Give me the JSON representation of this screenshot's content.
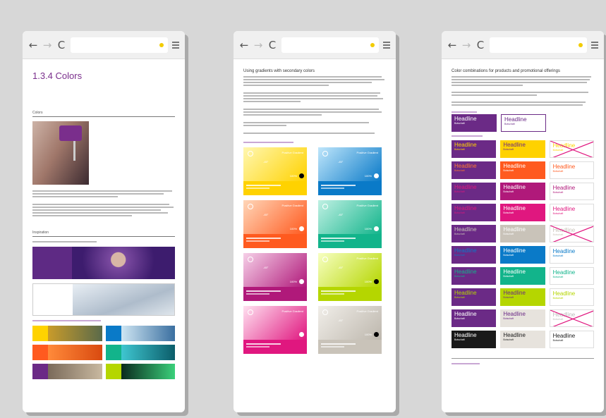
{
  "brand": {
    "purple": "#7a2e8c",
    "yellow": "#ffd200",
    "blue": "#0a7ac8"
  },
  "browser": {
    "back_icon": "←",
    "forward_icon": "→",
    "reload_icon": "C"
  },
  "screen1": {
    "title": "1.3.4 Colors",
    "section_colors": "Colors",
    "section_inspiration": "Inspiration"
  },
  "screen2": {
    "title": "Using gradients with secondary colors"
  },
  "screen3": {
    "title": "Color combinations for products and promotional offerings"
  },
  "gradient_tiles": [
    {
      "from": "#fff7b0",
      "to": "#ffd200",
      "bottom": "#ffd200",
      "label": "Positive Gradient",
      "angle": "-45°",
      "percent": "100%",
      "dark_dot": true
    },
    {
      "from": "#bfe6fb",
      "to": "#0a7ac8",
      "bottom": "#0a7ac8",
      "label": "Positive Gradient",
      "angle": "-45°",
      "percent": "100%",
      "dark_dot": false
    },
    {
      "from": "#ffd6b8",
      "to": "#ff5a1f",
      "bottom": "#ff5a1f",
      "label": "Positive Gradient",
      "angle": "-45°",
      "percent": "100%",
      "dark_dot": false
    },
    {
      "from": "#bff0e3",
      "to": "#12b48b",
      "bottom": "#12b48b",
      "label": "Positive Gradient",
      "angle": "-45°",
      "percent": "100%",
      "dark_dot": false
    },
    {
      "from": "#f6d0e8",
      "to": "#b0197a",
      "bottom": "#b0197a",
      "label": "",
      "angle": "-45°",
      "percent": "100%",
      "dark_dot": false
    },
    {
      "from": "#f7ffc2",
      "to": "#b5d600",
      "bottom": "#b5d600",
      "label": "Positive Gradient",
      "angle": "-45°",
      "percent": "100%",
      "dark_dot": true
    },
    {
      "from": "#ffe0f0",
      "to": "#e0177f",
      "bottom": "#e0177f",
      "label": "Positive Gradient",
      "angle": "",
      "percent": "",
      "dark_dot": false
    },
    {
      "from": "#f1eee9",
      "to": "#bdb7ad",
      "bottom": "#c9c3b9",
      "label": "Positive Gradient",
      "angle": "-45°",
      "percent": "100%",
      "dark_dot": true
    }
  ],
  "headline_rows": [
    [
      {
        "bg": "#6b2a86",
        "fg": "#ffffff",
        "text": "Headline",
        "sub": "Botschaft",
        "crossed": false,
        "border": ""
      },
      {
        "bg": "#ffffff",
        "fg": "#6b2a86",
        "text": "Headline",
        "sub": "Botschaft",
        "crossed": false,
        "border": "#6b2a86"
      }
    ],
    [
      {
        "bg": "#6b2a86",
        "fg": "#ffd200",
        "text": "Headline",
        "sub": "Botschaft",
        "crossed": false,
        "border": ""
      },
      {
        "bg": "#ffd200",
        "fg": "#6b2a86",
        "text": "Headline",
        "sub": "Botschaft",
        "crossed": false,
        "border": ""
      },
      {
        "bg": "#ffffff",
        "fg": "#ffd200",
        "text": "Headline",
        "sub": "Botschaft",
        "crossed": true,
        "border": "#ddd"
      }
    ],
    [
      {
        "bg": "#6b2a86",
        "fg": "#ff7a30",
        "text": "Headline",
        "sub": "Botschaft",
        "crossed": false,
        "border": ""
      },
      {
        "bg": "#ff5a1f",
        "fg": "#ffffff",
        "text": "Headline",
        "sub": "Botschaft",
        "crossed": false,
        "border": ""
      },
      {
        "bg": "#ffffff",
        "fg": "#ff5a1f",
        "text": "Headline",
        "sub": "Botschaft",
        "crossed": false,
        "border": "#ddd"
      }
    ],
    [
      {
        "bg": "#6b2a86",
        "fg": "#e0177f",
        "text": "Headline",
        "sub": "Botschaft",
        "crossed": false,
        "border": ""
      },
      {
        "bg": "#b0197a",
        "fg": "#ffffff",
        "text": "Headline",
        "sub": "Botschaft",
        "crossed": false,
        "border": ""
      },
      {
        "bg": "#ffffff",
        "fg": "#b0197a",
        "text": "Headline",
        "sub": "Botschaft",
        "crossed": false,
        "border": "#ddd"
      }
    ],
    [
      {
        "bg": "#6b2a86",
        "fg": "#e0177f",
        "text": "Headline",
        "sub": "Botschaft",
        "crossed": false,
        "border": ""
      },
      {
        "bg": "#e0177f",
        "fg": "#ffffff",
        "text": "Headline",
        "sub": "Botschaft",
        "crossed": false,
        "border": ""
      },
      {
        "bg": "#ffffff",
        "fg": "#e0177f",
        "text": "Headline",
        "sub": "Botschaft",
        "crossed": false,
        "border": "#ddd"
      }
    ],
    [
      {
        "bg": "#6b2a86",
        "fg": "#c9c3b9",
        "text": "Headline",
        "sub": "Botschaft",
        "crossed": false,
        "border": ""
      },
      {
        "bg": "#c9c3b9",
        "fg": "#ffffff",
        "text": "Headline",
        "sub": "Botschaft",
        "crossed": false,
        "border": ""
      },
      {
        "bg": "#ffffff",
        "fg": "#c9c3b9",
        "text": "Headline",
        "sub": "Botschaft",
        "crossed": true,
        "border": "#ddd"
      }
    ],
    [
      {
        "bg": "#6b2a86",
        "fg": "#0a7ac8",
        "text": "Headline",
        "sub": "Botschaft",
        "crossed": false,
        "border": ""
      },
      {
        "bg": "#0a7ac8",
        "fg": "#ffffff",
        "text": "Headline",
        "sub": "Botschaft",
        "crossed": false,
        "border": ""
      },
      {
        "bg": "#ffffff",
        "fg": "#0a7ac8",
        "text": "Headline",
        "sub": "Botschaft",
        "crossed": false,
        "border": "#ddd"
      }
    ],
    [
      {
        "bg": "#6b2a86",
        "fg": "#12b48b",
        "text": "Headline",
        "sub": "Botschaft",
        "crossed": false,
        "border": ""
      },
      {
        "bg": "#12b48b",
        "fg": "#ffffff",
        "text": "Headline",
        "sub": "Botschaft",
        "crossed": false,
        "border": ""
      },
      {
        "bg": "#ffffff",
        "fg": "#12b48b",
        "text": "Headline",
        "sub": "Botschaft",
        "crossed": false,
        "border": "#ddd"
      }
    ],
    [
      {
        "bg": "#6b2a86",
        "fg": "#b5d600",
        "text": "Headline",
        "sub": "Botschaft",
        "crossed": false,
        "border": ""
      },
      {
        "bg": "#b5d600",
        "fg": "#6b2a86",
        "text": "Headline",
        "sub": "Botschaft",
        "crossed": false,
        "border": ""
      },
      {
        "bg": "#ffffff",
        "fg": "#b5d600",
        "text": "Headline",
        "sub": "Botschaft",
        "crossed": false,
        "border": "#ddd"
      }
    ],
    [
      {
        "bg": "#6b2a86",
        "fg": "#ffffff",
        "text": "Headline",
        "sub": "Botschaft",
        "crossed": false,
        "border": ""
      },
      {
        "bg": "#e7e3dd",
        "fg": "#6b2a86",
        "text": "Headline",
        "sub": "Botschaft",
        "crossed": false,
        "border": ""
      },
      {
        "bg": "#ffffff",
        "fg": "#bbb",
        "text": "Headline",
        "sub": "Botschaft",
        "crossed": true,
        "border": "#ddd"
      }
    ],
    [
      {
        "bg": "#1a1a1a",
        "fg": "#ffffff",
        "text": "Headline",
        "sub": "Botschaft",
        "crossed": false,
        "border": ""
      },
      {
        "bg": "#e7e3dd",
        "fg": "#1a1a1a",
        "text": "Headline",
        "sub": "Botschaft",
        "crossed": false,
        "border": ""
      },
      {
        "bg": "#ffffff",
        "fg": "#1a1a1a",
        "text": "Headline",
        "sub": "Botschaft",
        "crossed": false,
        "border": "#ddd"
      }
    ]
  ]
}
